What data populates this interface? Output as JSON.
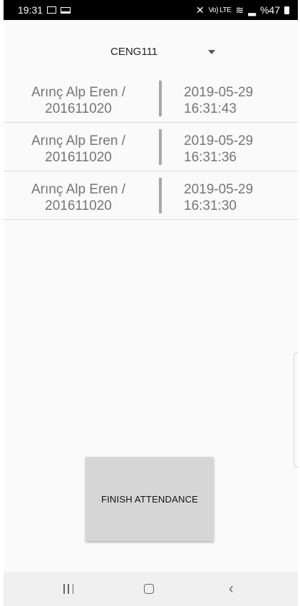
{
  "status_bar": {
    "time": "19:31",
    "network_label": "Vo) LTE",
    "battery": "%47"
  },
  "spinner": {
    "selected": "CENG111"
  },
  "attendance": [
    {
      "name": "Arınç Alp Eren /",
      "id": "201611020",
      "date": "2019-05-29",
      "time": "16:31:43"
    },
    {
      "name": "Arınç Alp Eren /",
      "id": "201611020",
      "date": "2019-05-29",
      "time": "16:31:36"
    },
    {
      "name": "Arınç Alp Eren /",
      "id": "201611020",
      "date": "2019-05-29",
      "time": "16:31:30"
    }
  ],
  "finish_button": {
    "label": "FINISH ATTENDANCE"
  },
  "colors": {
    "background": "#fafafa",
    "button": "#d6d6d6",
    "text_gray": "#757575",
    "divider": "#a8a8a8"
  }
}
